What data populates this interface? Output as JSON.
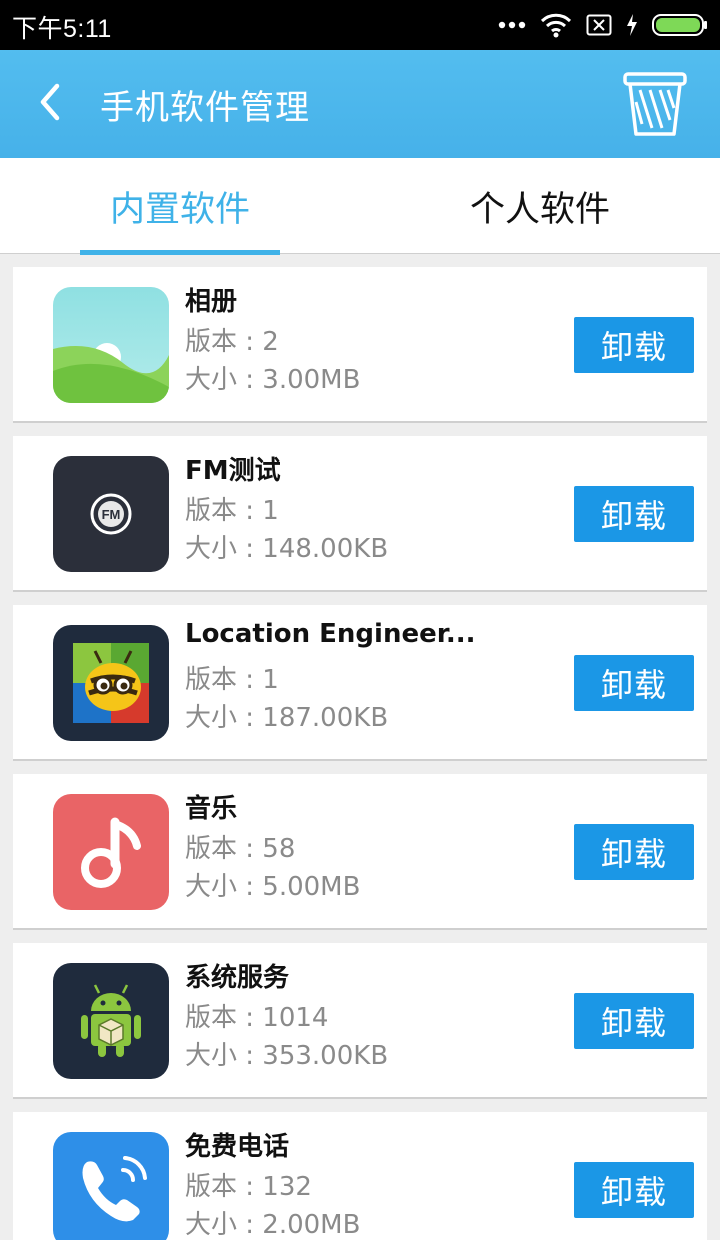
{
  "status_bar": {
    "time": "下午5:11"
  },
  "header": {
    "title": "手机软件管理",
    "back_icon": "back-arrow-icon",
    "trash_icon": "trash-icon"
  },
  "tabs": [
    {
      "label": "内置软件",
      "active": true
    },
    {
      "label": "个人软件",
      "active": false
    }
  ],
  "apps": [
    {
      "name": "相册",
      "version": "版本 : 2",
      "size": "大小 : 3.00MB",
      "icon": "gallery-icon",
      "action": "卸载"
    },
    {
      "name": "FM测试",
      "version": "版本 : 1",
      "size": "大小 : 148.00KB",
      "icon": "fm-radio-icon",
      "action": "卸载"
    },
    {
      "name": "Location Engineer...",
      "version": "版本 : 1",
      "size": "大小 : 187.00KB",
      "icon": "bee-icon",
      "action": "卸载"
    },
    {
      "name": "音乐",
      "version": "版本 : 58",
      "size": "大小 : 5.00MB",
      "icon": "music-note-icon",
      "action": "卸载"
    },
    {
      "name": "系统服务",
      "version": "版本 : 1014",
      "size": "大小 : 353.00KB",
      "icon": "android-robot-icon",
      "action": "卸载"
    },
    {
      "name": "免费电话",
      "version": "版本 : 132",
      "size": "大小 : 2.00MB",
      "icon": "phone-call-icon",
      "action": "卸载"
    }
  ],
  "colors": {
    "header": "#4cb8ee",
    "accent": "#3fb2e8",
    "button": "#1b97e6"
  }
}
